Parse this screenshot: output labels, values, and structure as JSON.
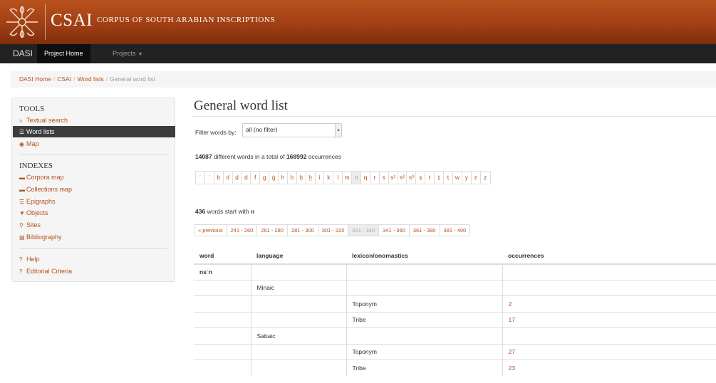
{
  "banner": {
    "brand_short": "CSAI",
    "brand_long": "CORPUS OF SOUTH ARABIAN INSCRIPTIONS"
  },
  "navbar": {
    "brand": "DASI",
    "project_home": "Project Home",
    "projects": "Projects"
  },
  "breadcrumb": {
    "items": [
      "DASI Home",
      "CSAI",
      "Word lists"
    ],
    "current": "General word list",
    "separator": "/"
  },
  "sidebar": {
    "tools_heading": "TOOLS",
    "tools": [
      {
        "label": "Textual search",
        "icon": "search-icon"
      },
      {
        "label": "Word lists",
        "icon": "list-icon",
        "active": true
      },
      {
        "label": "Map",
        "icon": "globe-icon"
      }
    ],
    "indexes_heading": "INDEXES",
    "indexes": [
      {
        "label": "Corpora map",
        "icon": "folder-open-icon"
      },
      {
        "label": "Collections map",
        "icon": "folder-open-icon"
      },
      {
        "label": "Epigraphs",
        "icon": "list-icon"
      },
      {
        "label": "Objects",
        "icon": "filter-icon"
      },
      {
        "label": "Sites",
        "icon": "map-marker-icon"
      },
      {
        "label": "Bibliography",
        "icon": "book-icon"
      }
    ],
    "help": [
      {
        "label": "Help",
        "icon": "question-circle-icon"
      },
      {
        "label": "Editorial Criteria",
        "icon": "question-circle-icon"
      }
    ]
  },
  "main": {
    "title": "General word list",
    "filter": {
      "label": "Filter words by:",
      "value": "all (no filter)"
    },
    "stats": {
      "words": "14087",
      "middle": "different words in a total of",
      "occurrences": "168992",
      "suffix": "occurrences"
    },
    "letters": [
      "ʾ",
      "ʿ",
      "b",
      "d",
      "ḏ",
      "ḍ",
      "f",
      "g",
      "ġ",
      "h",
      "ḥ",
      "ḫ",
      "ẖ",
      "i",
      "k",
      "l",
      "m",
      "n",
      "q",
      "r",
      "s",
      "s¹",
      "s²",
      "s³",
      "ṣ",
      "t",
      "ṯ",
      "ṭ",
      "w",
      "y",
      "z",
      "ẓ"
    ],
    "active_letter": "n",
    "count": {
      "number": "436",
      "text": "words start with",
      "letter": "n"
    },
    "pagination": [
      "« previous",
      "241 - 260",
      "261 - 280",
      "281 - 300",
      "301 - 320",
      "321 - 340",
      "341 - 360",
      "361 - 380",
      "381 - 400"
    ],
    "active_page": "321 - 340",
    "table": {
      "headers": [
        "word",
        "language",
        "lexicon/onomastics",
        "occurrences"
      ],
      "rows": [
        [
          "nsʾn",
          "",
          "",
          ""
        ],
        [
          "",
          "Minaic",
          "",
          ""
        ],
        [
          "",
          "",
          "Toponym",
          "2"
        ],
        [
          "",
          "",
          "Tribe",
          "17"
        ],
        [
          "",
          "Sabaic",
          "",
          ""
        ],
        [
          "",
          "",
          "Toponym",
          "27"
        ],
        [
          "",
          "",
          "Tribe",
          "23"
        ]
      ]
    }
  },
  "colors": {
    "banner": "#a13f14",
    "accent_link": "#b5511d",
    "navbar": "#222222",
    "active_sidebar": "#3c3c3c"
  }
}
